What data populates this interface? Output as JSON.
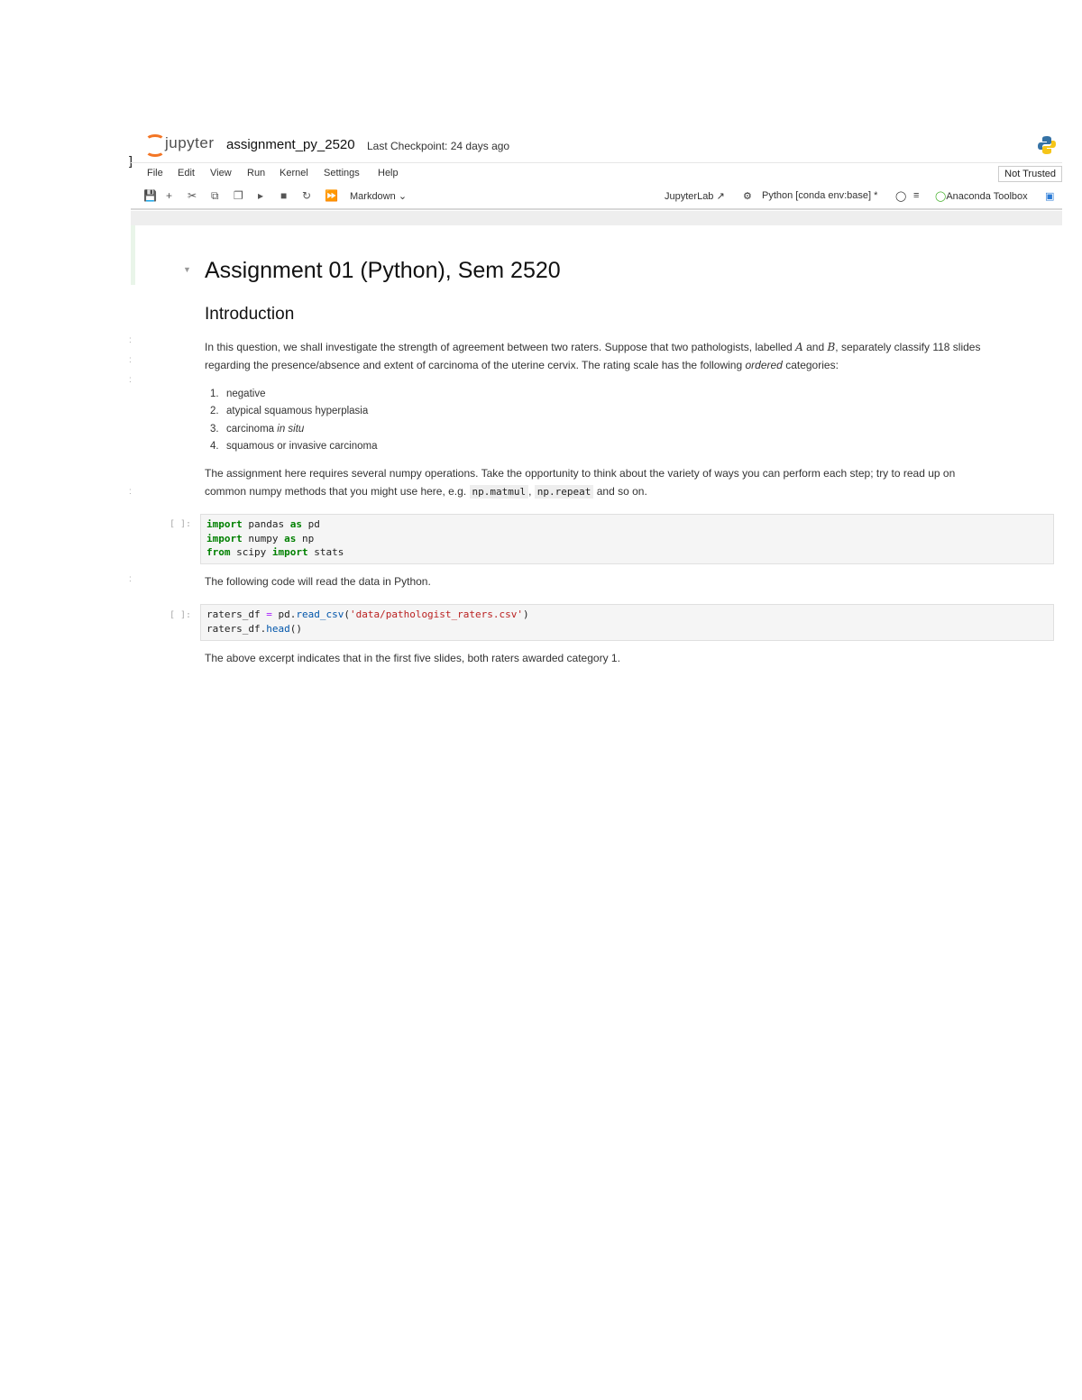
{
  "header": {
    "logo_text": "jupyter",
    "notebook_name": "assignment_py_2520",
    "checkpoint": "Last Checkpoint: 24 days ago"
  },
  "menu": [
    "File",
    "Edit",
    "View",
    "Run",
    "Kernel",
    "Settings",
    "Help"
  ],
  "trust_label": "Not Trusted",
  "toolbar": {
    "cell_type": "Markdown",
    "jupyterlab_label": "JupyterLab",
    "kernel_label": "Python [conda env:base] *",
    "anaconda_label": "Anaconda Toolbox"
  },
  "notebook": {
    "title": "Assignment 01 (Python), Sem 2520",
    "intro_heading": "Introduction",
    "intro_para_1": "In this question, we shall investigate the strength of agreement between two raters. Suppose that two pathologists, labelled",
    "rater_a": "A",
    "and_word": "and",
    "rater_b": "B",
    "intro_para_2": ", separately classify 118 slides",
    "intro_line_2a": "regarding the presence/absence and extent of carcinoma of the uterine cervix. The rating scale has the following",
    "intro_ordered": "ordered",
    "intro_line_2b": "categories:",
    "categories": [
      "negative",
      "atypical squamous hyperplasia",
      "carcinoma",
      "squamous or invasive carcinoma"
    ],
    "in_situ": "in situ",
    "assign_para_1": "The assignment here requires several numpy operations. Take the opportunity to think about the variety of ways you can perform each step; try to read up on",
    "assign_para_2": "common numpy methods that you might use here, e.g.",
    "code_1": "np.matmul",
    "code_2": "np.repeat",
    "assign_para_3": "and so on.",
    "prompt": "[ ]:",
    "read_para": "The following code will read the data in Python.",
    "excerpt_para": "The above excerpt indicates that in the first five slides, both raters awarded category 1.",
    "code_cell_1": {
      "l1_kw": "import",
      "l1_mod": "pandas",
      "l1_as": "as",
      "l1_alias": "pd",
      "l2_kw": "import",
      "l2_mod": "numpy",
      "l2_as": "as",
      "l2_alias": "np",
      "l3_from": "from",
      "l3_mod": "scipy",
      "l3_imp": "import",
      "l3_name": "stats"
    },
    "code_cell_2": {
      "l1_var": "raters_df",
      "l1_eq": "=",
      "l1_obj": "pd.",
      "l1_fn": "read_csv",
      "l1_open": "(",
      "l1_str": "'data/pathologist_raters.csv'",
      "l1_close": ")",
      "l2_obj": "raters_df.",
      "l2_fn": "head",
      "l2_call": "()"
    }
  },
  "colors": {
    "brand_orange": "#f37626",
    "keyword_green": "#008000",
    "string_red": "#ba2121"
  }
}
